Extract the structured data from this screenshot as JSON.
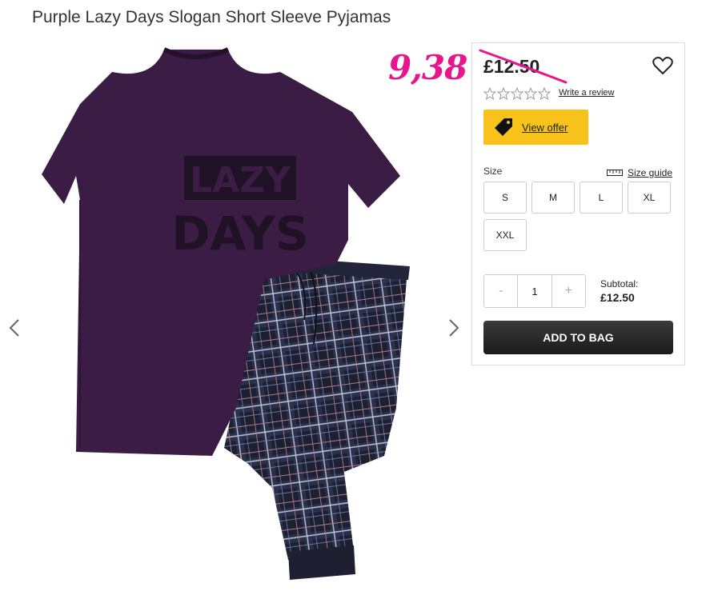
{
  "product": {
    "title": "Purple Lazy Days Slogan Short Sleeve Pyjamas",
    "image_alt": "Purple t-shirt with LAZY DAYS slogan and checked pyjama bottoms",
    "shirt_slogan": [
      "LAZY",
      "DAYS"
    ]
  },
  "price": {
    "old": "£12.50",
    "handwritten_new": "9,38"
  },
  "rating": {
    "stars": 0,
    "max": 5,
    "review_link": "Write a review"
  },
  "offer": {
    "label": "View offer"
  },
  "size": {
    "label": "Size",
    "guide_label": "Size guide",
    "options": [
      "S",
      "M",
      "L",
      "XL",
      "XXL"
    ]
  },
  "quantity": {
    "minus": "-",
    "value": "1",
    "plus": "+"
  },
  "subtotal": {
    "label": "Subtotal:",
    "amount": "£12.50"
  },
  "cart": {
    "add_label": "ADD TO BAG"
  },
  "colors": {
    "accent_yellow": "#f7c21a",
    "handwriting_pink": "#e8168c",
    "shirt_purple": "#3a1c45"
  },
  "icons": [
    "chevron-left-icon",
    "chevron-right-icon",
    "heart-icon",
    "star-icon",
    "tag-icon",
    "ruler-icon"
  ]
}
